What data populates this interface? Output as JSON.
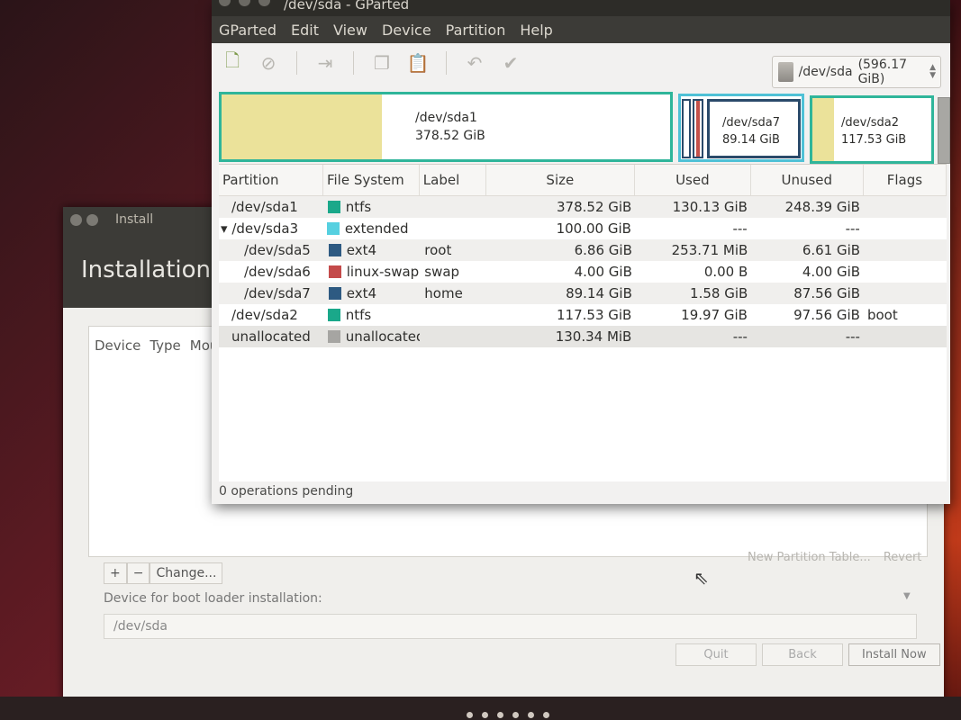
{
  "gparted": {
    "title": "/dev/sda - GParted",
    "menu": [
      "GParted",
      "Edit",
      "View",
      "Device",
      "Partition",
      "Help"
    ],
    "device_selector": {
      "device": "/dev/sda",
      "size": "(596.17 GiB)"
    },
    "partition_map": {
      "sda1": {
        "name": "/dev/sda1",
        "size": "378.52 GiB"
      },
      "sda7": {
        "name": "/dev/sda7",
        "size": "89.14 GiB"
      },
      "sda2": {
        "name": "/dev/sda2",
        "size": "117.53 GiB"
      }
    },
    "columns": [
      "Partition",
      "File System",
      "Label",
      "Size",
      "Used",
      "Unused",
      "Flags"
    ],
    "rows": [
      {
        "partition": "/dev/sda1",
        "fs": "ntfs",
        "color": "#1aa88a",
        "label": "",
        "size": "378.52 GiB",
        "used": "130.13 GiB",
        "unused": "248.39 GiB",
        "flags": ""
      },
      {
        "partition": "/dev/sda3",
        "fs": "extended",
        "color": "#56d0e0",
        "label": "",
        "size": "100.00 GiB",
        "used": "---",
        "unused": "---",
        "flags": ""
      },
      {
        "partition": "/dev/sda5",
        "fs": "ext4",
        "color": "#2e5a82",
        "label": "root",
        "size": "6.86 GiB",
        "used": "253.71 MiB",
        "unused": "6.61 GiB",
        "flags": ""
      },
      {
        "partition": "/dev/sda6",
        "fs": "linux-swap",
        "color": "#c44a4a",
        "label": "swap",
        "size": "4.00 GiB",
        "used": "0.00 B",
        "unused": "4.00 GiB",
        "flags": ""
      },
      {
        "partition": "/dev/sda7",
        "fs": "ext4",
        "color": "#2e5a82",
        "label": "home",
        "size": "89.14 GiB",
        "used": "1.58 GiB",
        "unused": "87.56 GiB",
        "flags": ""
      },
      {
        "partition": "/dev/sda2",
        "fs": "ntfs",
        "color": "#1aa88a",
        "label": "",
        "size": "117.53 GiB",
        "used": "19.97 GiB",
        "unused": "97.56 GiB",
        "flags": "boot"
      },
      {
        "partition": "unallocated",
        "fs": "unallocated",
        "color": "#a6a5a2",
        "label": "",
        "size": "130.34 MiB",
        "used": "---",
        "unused": "---",
        "flags": ""
      }
    ],
    "status": "0 operations pending"
  },
  "installer": {
    "title": "Install",
    "header": "Installation",
    "columns": [
      "Device",
      "Type",
      "Mou"
    ],
    "buttons": {
      "add": "+",
      "remove": "−",
      "change": "Change..."
    },
    "new_partition_table": "New Partition Table...",
    "revert": "Revert",
    "boot_label": "Device for boot loader installation:",
    "boot_device": "/dev/sda",
    "quit": "Quit",
    "back": "Back",
    "install_now": "Install Now"
  }
}
